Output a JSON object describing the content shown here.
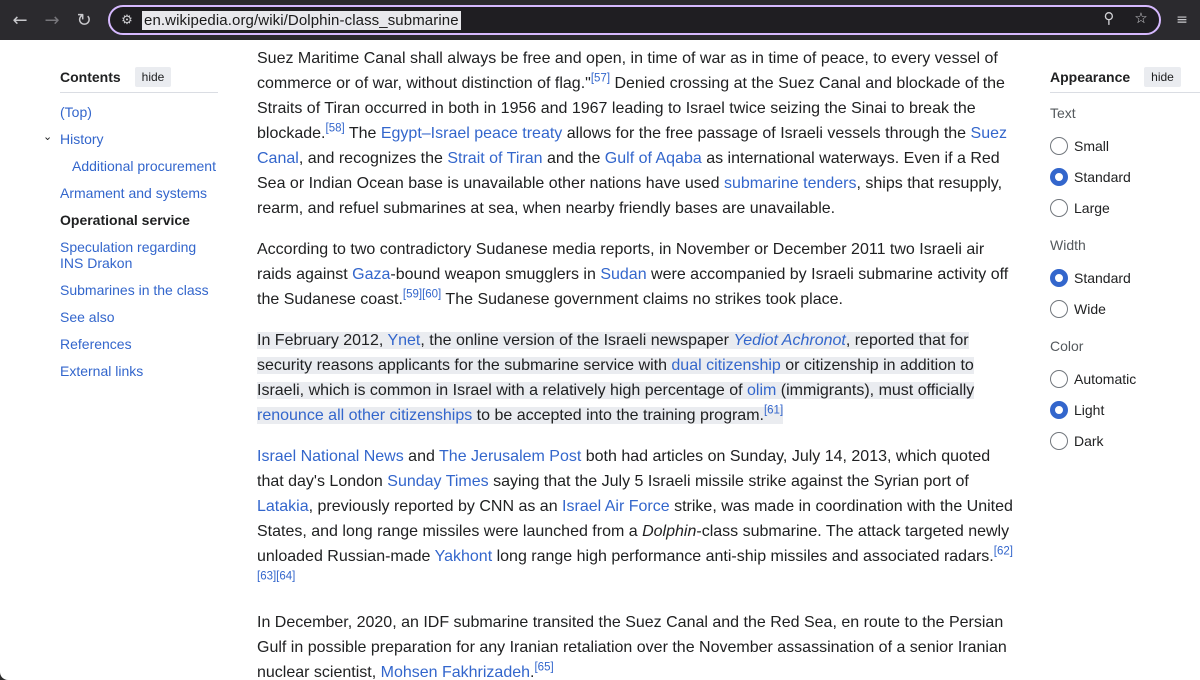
{
  "browser": {
    "url": "en.wikipedia.org/wiki/Dolphin-class_submarine",
    "back_glyph": "←",
    "forward_glyph": "→",
    "reload_glyph": "↻",
    "site_info_glyph": "⚙",
    "zoom_glyph": "⚲",
    "star_glyph": "☆",
    "ext_glyph": "≡"
  },
  "toc": {
    "title": "Contents",
    "hide_label": "hide",
    "chevron": "⌄",
    "items": [
      {
        "label": "(Top)"
      },
      {
        "label": "History"
      },
      {
        "label": "Additional procurement"
      },
      {
        "label": "Armament and systems"
      },
      {
        "label": "Operational service"
      },
      {
        "label": "Speculation regarding INS Drakon"
      },
      {
        "label": "Submarines in the class"
      },
      {
        "label": "See also"
      },
      {
        "label": "References"
      },
      {
        "label": "External links"
      }
    ]
  },
  "article": {
    "p1": {
      "t1": "Suez Maritime Canal shall always be free and open, in time of war as in time of peace, to every vessel of commerce or of war, without distinction of flag.\"",
      "r1": "[57]",
      "t2": " Denied crossing at the Suez Canal and blockade of the Straits of Tiran occurred in both in 1956 and 1967 leading to Israel twice seizing the Sinai to break the blockade.",
      "r2": "[58]",
      "t3": " The ",
      "l1": "Egypt–Israel peace treaty",
      "t4": " allows for the free passage of Israeli vessels through the ",
      "l2": "Suez Canal",
      "t5": ", and recognizes the ",
      "l3": "Strait of Tiran",
      "t6": " and the ",
      "l4": "Gulf of Aqaba",
      "t7": " as international waterways. Even if a Red Sea or Indian Ocean base is unavailable other nations have used ",
      "l5": "submarine tenders",
      "t8": ", ships that resupply, rearm, and refuel submarines at sea, when nearby friendly bases are unavailable."
    },
    "p2": {
      "t1": "According to two contradictory Sudanese media reports, in November or December 2011 two Israeli air raids against ",
      "l1": "Gaza",
      "t2": "-bound weapon smugglers in ",
      "l2": "Sudan",
      "t3": " were accompanied by Israeli submarine activity off the Sudanese coast.",
      "r1": "[59][60]",
      "t4": " The Sudanese government claims no strikes took place."
    },
    "p3": {
      "t1": "In February 2012, ",
      "l1": "Ynet",
      "t2": ", the online version of the Israeli newspaper ",
      "l2": "Yediot Achronot",
      "t3": ", reported that for security reasons applicants for the submarine service with ",
      "l3": "dual citizenship",
      "t4": " or citizenship in addition to Israeli, which is common in Israel with a relatively high percentage of ",
      "l4": "olim",
      "t5": " (immigrants), must officially ",
      "l5": "renounce all other citizenships",
      "t6": " to be accepted into the training program.",
      "r1": "[61]"
    },
    "p4": {
      "l1": "Israel National News",
      "t1": " and ",
      "l2": "The Jerusalem Post",
      "t2": " both had articles on Sunday, July 14, 2013, which quoted that day's London ",
      "l3": "Sunday Times",
      "t3": " saying that the July 5 Israeli missile strike against the Syrian port of ",
      "l4": "Latakia",
      "t4": ", previously reported by CNN as an ",
      "l5": "Israel Air Force",
      "t5": " strike, was made in coordination with the United States, and long range missiles were launched from a ",
      "i1": "Dolphin",
      "t6": "-class submarine. The attack targeted newly unloaded Russian-made ",
      "l6": "Yakhont",
      "t7": " long range high performance anti-ship missiles and associated radars.",
      "r1": "[62][63][64]"
    },
    "p5": {
      "t1": "In December, 2020, an IDF submarine transited the Suez Canal and the Red Sea, en route to the Persian Gulf in possible preparation for any Iranian retaliation over the November assassination of a senior Iranian nuclear scientist, ",
      "l1": "Mohsen Fakhrizadeh",
      "t2": ".",
      "r1": "[65]"
    }
  },
  "appearance": {
    "title": "Appearance",
    "hide_label": "hide",
    "text": {
      "label": "Text",
      "options": [
        "Small",
        "Standard",
        "Large"
      ],
      "selected": "Standard"
    },
    "width": {
      "label": "Width",
      "options": [
        "Standard",
        "Wide"
      ],
      "selected": "Standard"
    },
    "color": {
      "label": "Color",
      "options": [
        "Automatic",
        "Light",
        "Dark"
      ],
      "selected": "Light"
    }
  }
}
